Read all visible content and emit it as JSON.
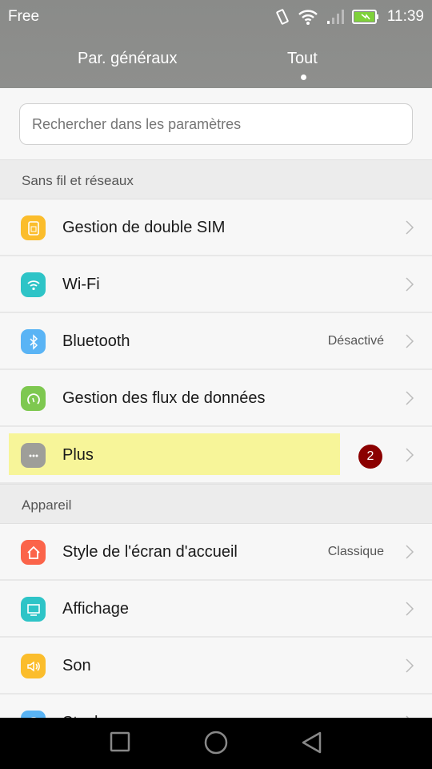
{
  "status": {
    "carrier": "Free",
    "time": "11:39",
    "icons": [
      "vibrate-icon",
      "wifi-icon",
      "signal-icon",
      "battery-charging-icon"
    ]
  },
  "tabs": [
    {
      "label": "Par. généraux",
      "active": false
    },
    {
      "label": "Tout",
      "active": true
    }
  ],
  "search": {
    "placeholder": "Rechercher dans les paramètres",
    "value": ""
  },
  "sections": [
    {
      "title": "Sans fil et réseaux",
      "items": [
        {
          "label": "Gestion de double SIM",
          "icon": "sim-card-icon",
          "color": "#fbbd2c",
          "value": ""
        },
        {
          "label": "Wi-Fi",
          "icon": "wifi-icon",
          "color": "#2ec4c7",
          "value": ""
        },
        {
          "label": "Bluetooth",
          "icon": "bluetooth-icon",
          "color": "#5ab4f5",
          "value": "Désactivé"
        },
        {
          "label": "Gestion des flux de données",
          "icon": "gauge-icon",
          "color": "#7ec850",
          "value": ""
        },
        {
          "label": "Plus",
          "icon": "more-icon",
          "color": "#9e9e99",
          "value": "",
          "badge": "2",
          "highlighted": true
        }
      ]
    },
    {
      "title": "Appareil",
      "items": [
        {
          "label": "Style de l'écran d'accueil",
          "icon": "home-icon",
          "color": "#fb644a",
          "value": "Classique"
        },
        {
          "label": "Affichage",
          "icon": "display-icon",
          "color": "#2ec4c7",
          "value": ""
        },
        {
          "label": "Son",
          "icon": "speaker-icon",
          "color": "#fbbd2c",
          "value": ""
        },
        {
          "label": "Stockage",
          "icon": "storage-icon",
          "color": "#5ab4f5",
          "value": ""
        }
      ]
    }
  ],
  "navbar": [
    "recents-button",
    "home-button",
    "back-button"
  ]
}
